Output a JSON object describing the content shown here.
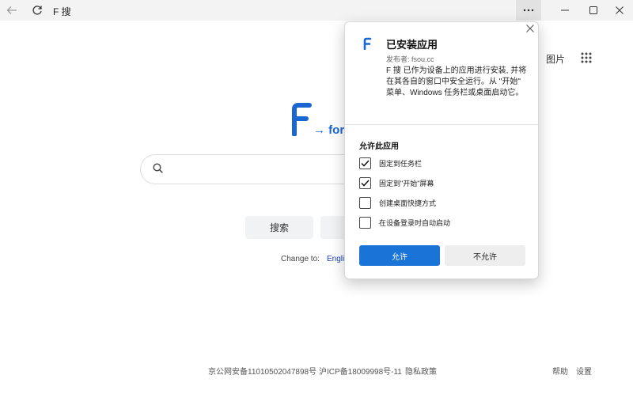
{
  "titlebar": {
    "app_title": "F 搜"
  },
  "page": {
    "logo_text": "→ forn",
    "search_button": "搜索",
    "change_to_label": "Change to:",
    "change_to_lang": "Engli",
    "images_link": "图片"
  },
  "footer": {
    "beian_police": "京公网安备11010502047898号",
    "icp": "沪ICP备18009998号-11",
    "privacy": "隐私政策",
    "help": "帮助",
    "settings": "设置"
  },
  "popup": {
    "title": "已安装应用",
    "publisher": "发布者: fsou.cc",
    "description": "F 搜 已作为设备上的应用进行安装, 并将在其各自的窗口中安全运行。从 \"开始\" 菜单、Windows 任务栏或桌面启动它。",
    "section_label": "允许此应用",
    "options": [
      {
        "label": "固定到任务栏",
        "checked": true
      },
      {
        "label": "固定到\"开始\"屏幕",
        "checked": true
      },
      {
        "label": "创建桌面快捷方式",
        "checked": false
      },
      {
        "label": "在设备登录时自动启动",
        "checked": false
      }
    ],
    "allow_button": "允许",
    "deny_button": "不允许"
  },
  "colors": {
    "accent": "#1a73d6",
    "logo_blue": "#1a67d2",
    "titlebar_bg": "#f3f3f3"
  }
}
